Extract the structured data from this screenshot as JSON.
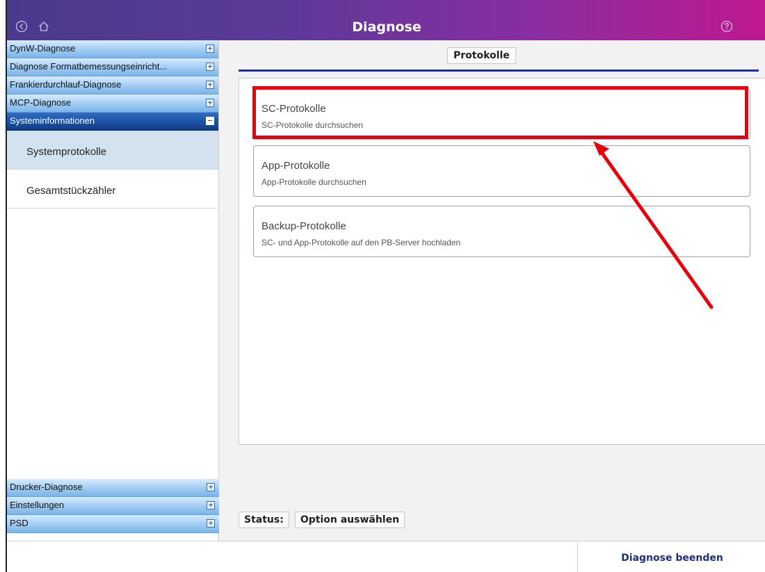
{
  "header": {
    "title": "Diagnose"
  },
  "sidebar": {
    "top_sections": [
      {
        "label": "DynW-Diagnose",
        "toggle": "+"
      },
      {
        "label": "Diagnose Formatbemessungseinricht...",
        "toggle": "+"
      },
      {
        "label": "Frankierdurchlauf-Diagnose",
        "toggle": "+"
      },
      {
        "label": "MCP-Diagnose",
        "toggle": "+"
      },
      {
        "label": "Systeminformationen",
        "toggle": "−"
      }
    ],
    "sub_items": [
      {
        "label": "Systemprotokolle"
      },
      {
        "label": "Gesamtstückzähler"
      }
    ],
    "bottom_sections": [
      {
        "label": "Drucker-Diagnose",
        "toggle": "+"
      },
      {
        "label": "Einstellungen",
        "toggle": "+"
      },
      {
        "label": "PSD",
        "toggle": "+"
      }
    ]
  },
  "main": {
    "tab_label": "Protokolle",
    "cards": [
      {
        "title": "SC-Protokolle",
        "subtitle": "SC-Protokolle durchsuchen"
      },
      {
        "title": "App-Protokolle",
        "subtitle": "App-Protokolle durchsuchen"
      },
      {
        "title": "Backup-Protokolle",
        "subtitle": "SC- und App-Protokolle auf den PB-Server hochladen"
      }
    ],
    "status_label": "Status:",
    "status_value": "Option auswählen"
  },
  "footer": {
    "end_button": "Diagnose beenden"
  },
  "colors": {
    "highlight": "#e8000d",
    "accent": "#1f2f8f",
    "active_section": "#1a4fa0"
  },
  "icons": {
    "back": "back-circle-icon",
    "home": "home-icon",
    "help": "help-circle-icon"
  }
}
